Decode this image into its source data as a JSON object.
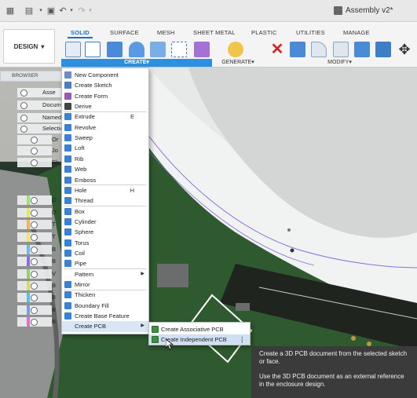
{
  "window": {
    "title": "Assembly v2*"
  },
  "ribbon": {
    "workspace_button": "DESIGN",
    "tabs": [
      {
        "label": "SOLID",
        "active": true
      },
      {
        "label": "SURFACE"
      },
      {
        "label": "MESH"
      },
      {
        "label": "SHEET METAL"
      },
      {
        "label": "PLASTIC"
      },
      {
        "label": "UTILITIES"
      },
      {
        "label": "MANAGE"
      }
    ],
    "groups": {
      "create": "CREATE",
      "generate": "GENERATE",
      "modify": "MODIFY"
    },
    "dropdown_arrow": "▾",
    "accent": "#2d8fe0"
  },
  "browser": {
    "title": "BROWSER",
    "rows": [
      "Asse",
      "Docum",
      "Named",
      "Selectio",
      "Or",
      "Jo",
      "Sk",
      "O",
      "O",
      "T",
      "T",
      "B",
      "B",
      "V",
      "B",
      "B",
      "B",
      "B"
    ]
  },
  "create_menu": {
    "items": [
      {
        "label": "New Component",
        "icon": "component-icon",
        "color": "#6b8fbf"
      },
      {
        "label": "Create Sketch",
        "icon": "sketch-icon",
        "color": "#4a7fc1"
      },
      {
        "label": "Create Form",
        "icon": "form-icon",
        "color": "#9b59b6"
      },
      {
        "label": "Derive",
        "icon": "derive-icon",
        "color": "#444444"
      },
      {
        "label": "Extrude",
        "icon": "extrude-icon",
        "color": "#3a83d4",
        "shortcut": "E"
      },
      {
        "label": "Revolve",
        "icon": "revolve-icon",
        "color": "#3a83d4"
      },
      {
        "label": "Sweep",
        "icon": "sweep-icon",
        "color": "#3a83d4"
      },
      {
        "label": "Loft",
        "icon": "loft-icon",
        "color": "#3a83d4"
      },
      {
        "label": "Rib",
        "icon": "rib-icon",
        "color": "#3a83d4"
      },
      {
        "label": "Web",
        "icon": "web-icon",
        "color": "#3a83d4"
      },
      {
        "label": "Emboss",
        "icon": "emboss-icon",
        "color": "#3a83d4"
      },
      {
        "label": "Hole",
        "icon": "hole-icon",
        "color": "#3a83d4",
        "shortcut": "H"
      },
      {
        "label": "Thread",
        "icon": "thread-icon",
        "color": "#3a83d4"
      },
      {
        "label": "Box",
        "icon": "box-icon",
        "color": "#3a83d4"
      },
      {
        "label": "Cylinder",
        "icon": "cylinder-icon",
        "color": "#3a83d4"
      },
      {
        "label": "Sphere",
        "icon": "sphere-icon",
        "color": "#3a83d4"
      },
      {
        "label": "Torus",
        "icon": "torus-icon",
        "color": "#3a83d4"
      },
      {
        "label": "Coil",
        "icon": "coil-icon",
        "color": "#3a83d4"
      },
      {
        "label": "Pipe",
        "icon": "pipe-icon",
        "color": "#3a83d4"
      },
      {
        "label": "Pattern",
        "icon": "",
        "color": "",
        "submenu": true
      },
      {
        "label": "Mirror",
        "icon": "mirror-icon",
        "color": "#3a83d4"
      },
      {
        "label": "Thicken",
        "icon": "thicken-icon",
        "color": "#3a83d4"
      },
      {
        "label": "Boundary Fill",
        "icon": "boundary-fill-icon",
        "color": "#3a83d4"
      },
      {
        "label": "Create Base Feature",
        "icon": "base-feature-icon",
        "color": "#3a83d4"
      },
      {
        "label": "Create PCB",
        "icon": "",
        "color": "",
        "submenu": true,
        "highlighted": true
      }
    ],
    "submenu_arrow": "▶"
  },
  "pcb_submenu": {
    "items": [
      {
        "label": "Create Associative PCB",
        "highlighted": false
      },
      {
        "label": "Create Independent PCB",
        "highlighted": true
      }
    ],
    "more": "⋮"
  },
  "tooltip": {
    "line1": "Create a 3D PCB document from the selected sketch or face.",
    "line2": "Use the 3D PCB document as an external reference in the enclosure design."
  }
}
